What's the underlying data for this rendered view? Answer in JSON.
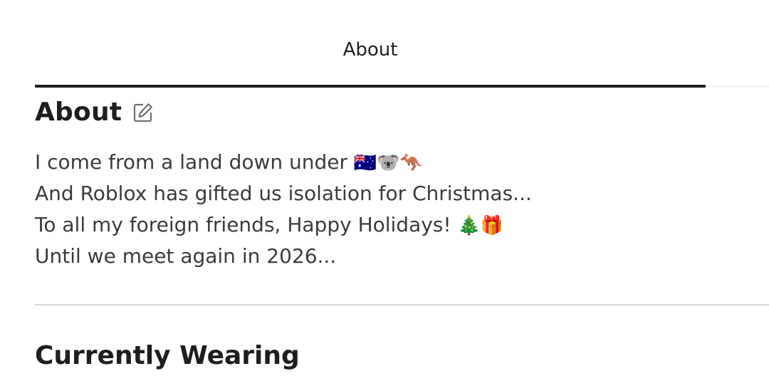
{
  "tab": {
    "label": "About"
  },
  "about": {
    "title": "About",
    "edit_icon": "edit-pencil-icon",
    "bio_lines": [
      {
        "text": "I come from a land down under ",
        "emoji": "🇦🇺🐨🦘"
      },
      {
        "text": "And Roblox has gifted us isolation for Christmas...",
        "emoji": ""
      },
      {
        "text": "To all my foreign friends, Happy Holidays! ",
        "emoji": "🎄🎁"
      },
      {
        "text": "Until we meet again in 2026...",
        "emoji": ""
      }
    ]
  },
  "wearing": {
    "title": "Currently Wearing"
  },
  "colors": {
    "underline": "#1b1c1e",
    "text": "#393b3d",
    "heading": "#1d1e20",
    "divider": "#d7d8d9"
  }
}
